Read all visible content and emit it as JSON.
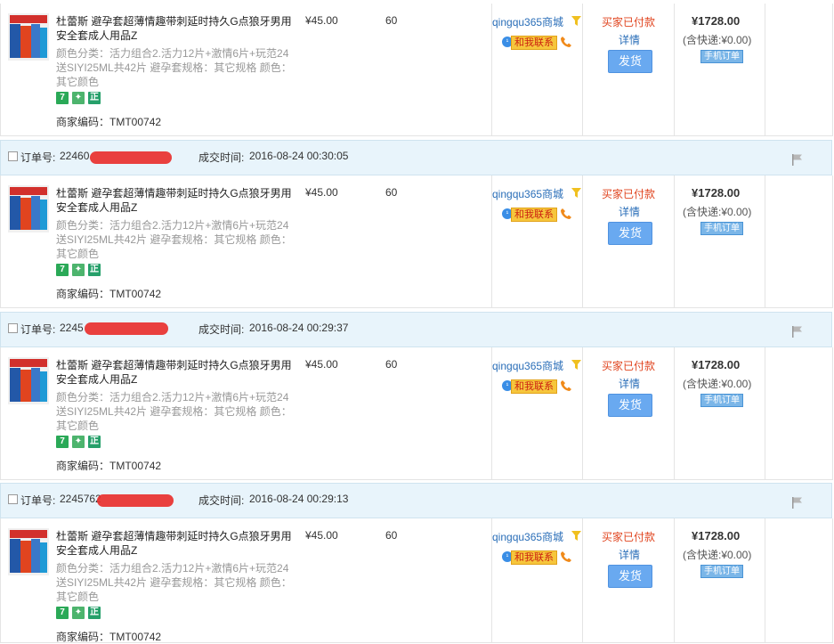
{
  "product": {
    "title": "杜蕾斯 避孕套超薄情趣带刺延时持久G点狼牙男用安全套成人用品Z",
    "attrs": "颜色分类：活力组合2.活力12片+激情6片+玩范24送SIYI25ML共42片  避孕套规格：其它规格  颜色：其它颜色",
    "code_label": "商家编码：",
    "code": "TMT00742",
    "badge_7": "7",
    "badge_shield": "✦",
    "badge_zheng": "正",
    "thumb_label": "要你二 42片"
  },
  "price": "¥45.00",
  "qty": "60",
  "shop": "qingqu365商城",
  "contact": "和我联系",
  "status": "买家已付款",
  "detail": "详情",
  "ship_button": "发货",
  "total": "¥1728.00",
  "shipping": "(含快递:¥0.00)",
  "mobile_tag": "手机订单",
  "header_labels": {
    "order_no": "订单号:",
    "deal_time": "成交时间:"
  },
  "orders": [
    {
      "order_no_visible": "22460",
      "time": "2016-08-24 00:30:05"
    },
    {
      "order_no_visible": "2245",
      "time": "2016-08-24 00:29:37"
    },
    {
      "order_no_visible": "2245762",
      "time": "2016-08-24 00:29:13"
    }
  ],
  "colors": {
    "header_bg": "#e8f4fb",
    "status": "#e0441f",
    "link": "#2a6eb8",
    "ship_button": "#69a9f0",
    "redaction": "#e8302e"
  },
  "icons": [
    "product-thumbnail",
    "filter-icon",
    "phone-icon",
    "flag-icon",
    "checkbox"
  ]
}
